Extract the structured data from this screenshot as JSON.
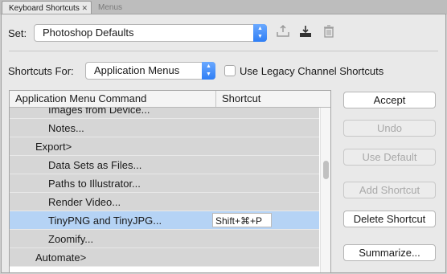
{
  "tabs": [
    {
      "label": "Keyboard Shortcuts",
      "close": "✕"
    },
    {
      "label": "Menus"
    }
  ],
  "set": {
    "label": "Set:",
    "value": "Photoshop Defaults"
  },
  "shortcuts_for": {
    "label": "Shortcuts For:",
    "value": "Application Menus",
    "legacy_label": "Use Legacy Channel Shortcuts"
  },
  "table": {
    "col_command": "Application Menu Command",
    "col_shortcut": "Shortcut",
    "rows": [
      {
        "label": "Images from Device..."
      },
      {
        "label": "Notes..."
      },
      {
        "label": "Export>"
      },
      {
        "label": "Data Sets as Files..."
      },
      {
        "label": "Paths to Illustrator..."
      },
      {
        "label": "Render Video..."
      },
      {
        "label": "TinyPNG and TinyJPG...",
        "shortcut": "Shift+⌘+P"
      },
      {
        "label": "Zoomify..."
      },
      {
        "label": "Automate>"
      }
    ]
  },
  "buttons": {
    "accept": "Accept",
    "undo": "Undo",
    "use_default": "Use Default",
    "add_shortcut": "Add Shortcut",
    "delete_shortcut": "Delete Shortcut",
    "summarize": "Summarize..."
  },
  "colors": {
    "selection": "#b5d3f5",
    "accent": "#2f7ef5"
  }
}
